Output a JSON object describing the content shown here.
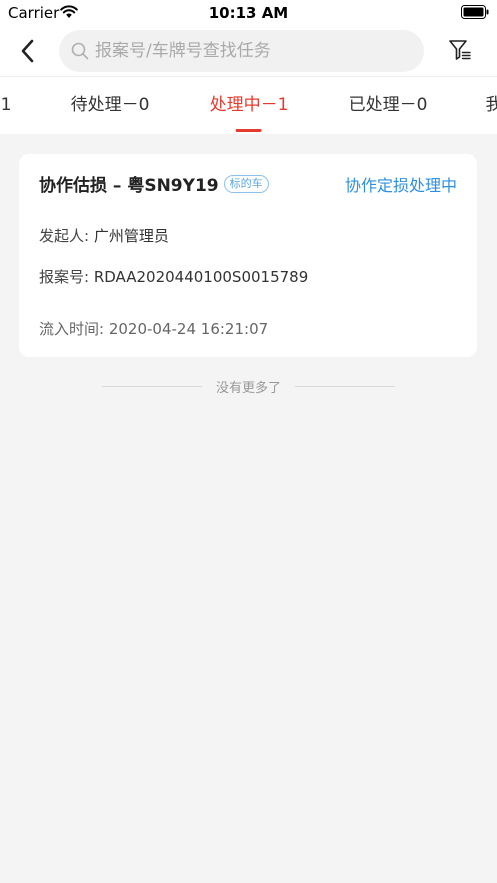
{
  "status_bar": {
    "carrier": "Carrier",
    "time": "10:13 AM"
  },
  "search": {
    "placeholder": "报案号/车牌号查找任务",
    "value": ""
  },
  "tabs": [
    {
      "label": "1"
    },
    {
      "label": "待处理－0"
    },
    {
      "label": "处理中－1"
    },
    {
      "label": "已处理－0"
    },
    {
      "label": "我"
    }
  ],
  "active_tab_index": 2,
  "task_card": {
    "title": "协作估损 – 粤SN9Y19",
    "tag": "标的车",
    "status": "协作定损处理中",
    "initiator_label": "发起人:",
    "initiator_value": "广州管理员",
    "case_no_label": "报案号:",
    "case_no_value": "RDAA2020440100S0015789",
    "inflow_time_label": "流入时间:",
    "inflow_time_value": "2020-04-24 16:21:07"
  },
  "list_end_text": "没有更多了",
  "colors": {
    "accent_red": "#e63a2e",
    "status_blue": "#2e8fe0",
    "tag_blue": "#5aa8e6",
    "background": "#f4f4f4"
  },
  "icons": [
    "wifi-icon",
    "battery-icon",
    "back-chevron-icon",
    "search-icon",
    "filter-icon"
  ]
}
